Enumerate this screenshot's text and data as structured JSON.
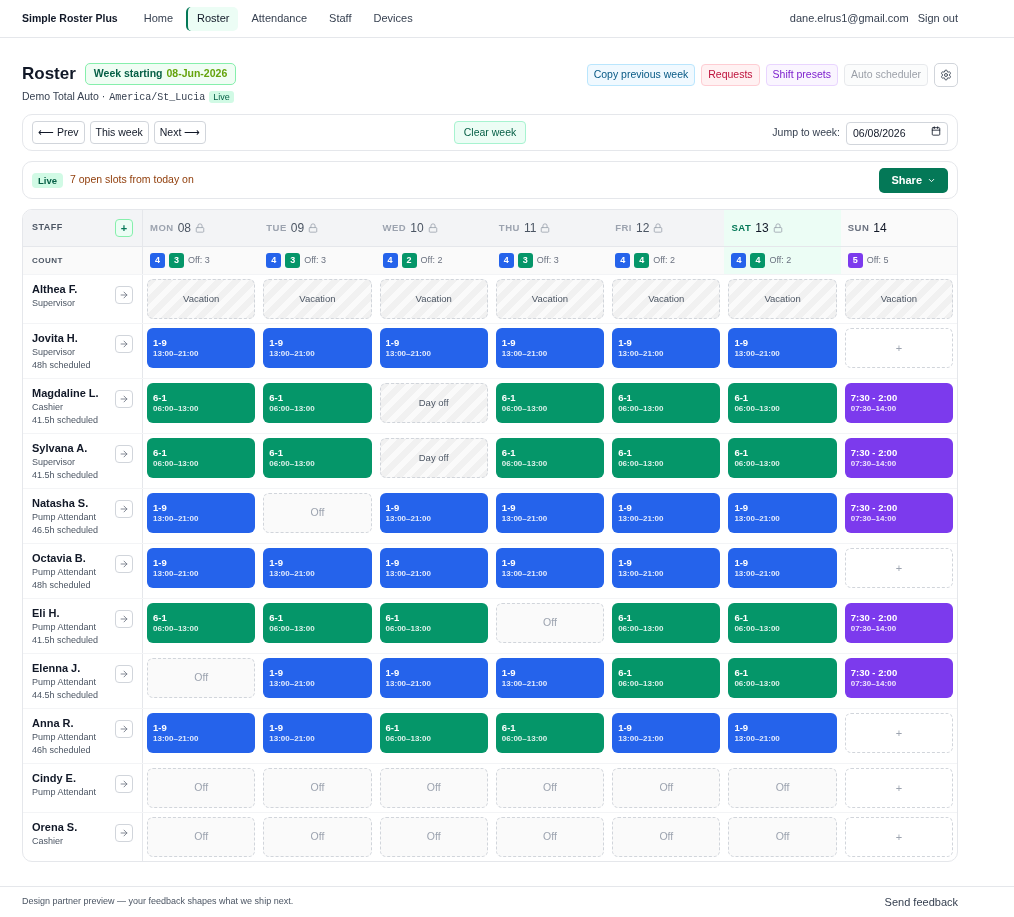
{
  "nav": {
    "brand": "Simple Roster Plus",
    "items": [
      {
        "label": "Home",
        "selected": false
      },
      {
        "label": "Roster",
        "selected": true
      },
      {
        "label": "Attendance",
        "selected": false
      },
      {
        "label": "Staff",
        "selected": false
      },
      {
        "label": "Devices",
        "selected": false
      }
    ],
    "user_email": "dane.elrus1@gmail.com",
    "sign_out": "Sign out"
  },
  "header": {
    "title": "Roster",
    "week_badge": {
      "label": "Week starting",
      "date": "08-Jun-2026"
    },
    "org": "Demo Total Auto ·",
    "timezone": "America/St_Lucia",
    "live_badge": "Live",
    "actions": [
      {
        "label": "Copy previous week",
        "kind": "info",
        "disabled": false
      },
      {
        "label": "Requests",
        "kind": "danger",
        "disabled": false
      },
      {
        "label": "Shift presets",
        "kind": "accent",
        "disabled": false
      },
      {
        "label": "Auto scheduler",
        "kind": "neutral",
        "disabled": true
      }
    ]
  },
  "week_nav": {
    "buttons": [
      "⟵ Prev",
      "This week",
      "Next ⟶"
    ],
    "clear_button": "Clear week",
    "jump_label": "Jump to week:",
    "jump_value": "06/08/2026"
  },
  "status": {
    "badge": "Live",
    "message": "7 open slots from today on",
    "share_button": "Share"
  },
  "roster": {
    "staff_heading": "STAFF",
    "add_button": "+",
    "count_heading": "COUNT",
    "days": [
      {
        "name": "MON",
        "date": "08",
        "locked": true,
        "today": false,
        "counts": [
          {
            "value": "4",
            "color": "#2563eb"
          },
          {
            "value": "3",
            "color": "#059669"
          }
        ],
        "off": "Off: 3"
      },
      {
        "name": "TUE",
        "date": "09",
        "locked": true,
        "today": false,
        "counts": [
          {
            "value": "4",
            "color": "#2563eb"
          },
          {
            "value": "3",
            "color": "#059669"
          }
        ],
        "off": "Off: 3"
      },
      {
        "name": "WED",
        "date": "10",
        "locked": true,
        "today": false,
        "counts": [
          {
            "value": "4",
            "color": "#2563eb"
          },
          {
            "value": "2",
            "color": "#059669"
          }
        ],
        "off": "Off: 2"
      },
      {
        "name": "THU",
        "date": "11",
        "locked": true,
        "today": false,
        "counts": [
          {
            "value": "4",
            "color": "#2563eb"
          },
          {
            "value": "3",
            "color": "#059669"
          }
        ],
        "off": "Off: 3"
      },
      {
        "name": "FRI",
        "date": "12",
        "locked": true,
        "today": false,
        "counts": [
          {
            "value": "4",
            "color": "#2563eb"
          },
          {
            "value": "4",
            "color": "#059669"
          }
        ],
        "off": "Off: 2"
      },
      {
        "name": "SAT",
        "date": "13",
        "locked": true,
        "today": true,
        "counts": [
          {
            "value": "4",
            "color": "#2563eb"
          },
          {
            "value": "4",
            "color": "#059669"
          }
        ],
        "off": "Off: 2"
      },
      {
        "name": "SUN",
        "date": "14",
        "locked": false,
        "today": false,
        "counts": [
          {
            "value": "5",
            "color": "#7c3aed"
          }
        ],
        "off": "Off: 5"
      }
    ],
    "staff": [
      {
        "name": "Althea F.",
        "role": "Supervisor",
        "cells": [
          {
            "kind": "vacation",
            "label": "Vacation"
          },
          {
            "kind": "vacation",
            "label": "Vacation"
          },
          {
            "kind": "vacation",
            "label": "Vacation"
          },
          {
            "kind": "vacation",
            "label": "Vacation"
          },
          {
            "kind": "vacation",
            "label": "Vacation"
          },
          {
            "kind": "vacation",
            "label": "Vacation"
          },
          {
            "kind": "vacation",
            "label": "Vacation"
          }
        ]
      },
      {
        "name": "Jovita H.",
        "role": "Supervisor",
        "hours": "48h scheduled",
        "cells": [
          {
            "kind": "shift",
            "code": "1-9",
            "time": "13:00–21:00",
            "color": "#2563eb"
          },
          {
            "kind": "shift",
            "code": "1-9",
            "time": "13:00–21:00",
            "color": "#2563eb"
          },
          {
            "kind": "shift",
            "code": "1-9",
            "time": "13:00–21:00",
            "color": "#2563eb"
          },
          {
            "kind": "shift",
            "code": "1-9",
            "time": "13:00–21:00",
            "color": "#2563eb"
          },
          {
            "kind": "shift",
            "code": "1-9",
            "time": "13:00–21:00",
            "color": "#2563eb"
          },
          {
            "kind": "shift",
            "code": "1-9",
            "time": "13:00–21:00",
            "color": "#2563eb"
          },
          {
            "kind": "empty",
            "label": "+"
          }
        ]
      },
      {
        "name": "Magdaline L.",
        "role": "Cashier",
        "hours": "41.5h scheduled",
        "cells": [
          {
            "kind": "shift",
            "code": "6-1",
            "time": "06:00–13:00",
            "color": "#059669"
          },
          {
            "kind": "shift",
            "code": "6-1",
            "time": "06:00–13:00",
            "color": "#059669"
          },
          {
            "kind": "day_off",
            "label": "Day off"
          },
          {
            "kind": "shift",
            "code": "6-1",
            "time": "06:00–13:00",
            "color": "#059669"
          },
          {
            "kind": "shift",
            "code": "6-1",
            "time": "06:00–13:00",
            "color": "#059669"
          },
          {
            "kind": "shift",
            "code": "6-1",
            "time": "06:00–13:00",
            "color": "#059669"
          },
          {
            "kind": "shift",
            "code": "7:30 - 2:00",
            "time": "07:30–14:00",
            "color": "#7c3aed"
          }
        ]
      },
      {
        "name": "Sylvana A.",
        "role": "Supervisor",
        "hours": "41.5h scheduled",
        "cells": [
          {
            "kind": "shift",
            "code": "6-1",
            "time": "06:00–13:00",
            "color": "#059669"
          },
          {
            "kind": "shift",
            "code": "6-1",
            "time": "06:00–13:00",
            "color": "#059669"
          },
          {
            "kind": "day_off",
            "label": "Day off"
          },
          {
            "kind": "shift",
            "code": "6-1",
            "time": "06:00–13:00",
            "color": "#059669"
          },
          {
            "kind": "shift",
            "code": "6-1",
            "time": "06:00–13:00",
            "color": "#059669"
          },
          {
            "kind": "shift",
            "code": "6-1",
            "time": "06:00–13:00",
            "color": "#059669"
          },
          {
            "kind": "shift",
            "code": "7:30 - 2:00",
            "time": "07:30–14:00",
            "color": "#7c3aed"
          }
        ]
      },
      {
        "name": "Natasha S.",
        "role": "Pump Attendant",
        "hours": "46.5h scheduled",
        "cells": [
          {
            "kind": "shift",
            "code": "1-9",
            "time": "13:00–21:00",
            "color": "#2563eb"
          },
          {
            "kind": "off",
            "label": "Off"
          },
          {
            "kind": "shift",
            "code": "1-9",
            "time": "13:00–21:00",
            "color": "#2563eb"
          },
          {
            "kind": "shift",
            "code": "1-9",
            "time": "13:00–21:00",
            "color": "#2563eb"
          },
          {
            "kind": "shift",
            "code": "1-9",
            "time": "13:00–21:00",
            "color": "#2563eb"
          },
          {
            "kind": "shift",
            "code": "1-9",
            "time": "13:00–21:00",
            "color": "#2563eb"
          },
          {
            "kind": "shift",
            "code": "7:30 - 2:00",
            "time": "07:30–14:00",
            "color": "#7c3aed"
          }
        ]
      },
      {
        "name": "Octavia B.",
        "role": "Pump Attendant",
        "hours": "48h scheduled",
        "cells": [
          {
            "kind": "shift",
            "code": "1-9",
            "time": "13:00–21:00",
            "color": "#2563eb"
          },
          {
            "kind": "shift",
            "code": "1-9",
            "time": "13:00–21:00",
            "color": "#2563eb"
          },
          {
            "kind": "shift",
            "code": "1-9",
            "time": "13:00–21:00",
            "color": "#2563eb"
          },
          {
            "kind": "shift",
            "code": "1-9",
            "time": "13:00–21:00",
            "color": "#2563eb"
          },
          {
            "kind": "shift",
            "code": "1-9",
            "time": "13:00–21:00",
            "color": "#2563eb"
          },
          {
            "kind": "shift",
            "code": "1-9",
            "time": "13:00–21:00",
            "color": "#2563eb"
          },
          {
            "kind": "empty",
            "label": "+"
          }
        ]
      },
      {
        "name": "Eli H.",
        "role": "Pump Attendant",
        "hours": "41.5h scheduled",
        "cells": [
          {
            "kind": "shift",
            "code": "6-1",
            "time": "06:00–13:00",
            "color": "#059669"
          },
          {
            "kind": "shift",
            "code": "6-1",
            "time": "06:00–13:00",
            "color": "#059669"
          },
          {
            "kind": "shift",
            "code": "6-1",
            "time": "06:00–13:00",
            "color": "#059669"
          },
          {
            "kind": "off",
            "label": "Off"
          },
          {
            "kind": "shift",
            "code": "6-1",
            "time": "06:00–13:00",
            "color": "#059669"
          },
          {
            "kind": "shift",
            "code": "6-1",
            "time": "06:00–13:00",
            "color": "#059669"
          },
          {
            "kind": "shift",
            "code": "7:30 - 2:00",
            "time": "07:30–14:00",
            "color": "#7c3aed"
          }
        ]
      },
      {
        "name": "Elenna J.",
        "role": "Pump Attendant",
        "hours": "44.5h scheduled",
        "cells": [
          {
            "kind": "off",
            "label": "Off"
          },
          {
            "kind": "shift",
            "code": "1-9",
            "time": "13:00–21:00",
            "color": "#2563eb"
          },
          {
            "kind": "shift",
            "code": "1-9",
            "time": "13:00–21:00",
            "color": "#2563eb"
          },
          {
            "kind": "shift",
            "code": "1-9",
            "time": "13:00–21:00",
            "color": "#2563eb"
          },
          {
            "kind": "shift",
            "code": "6-1",
            "time": "06:00–13:00",
            "color": "#059669"
          },
          {
            "kind": "shift",
            "code": "6-1",
            "time": "06:00–13:00",
            "color": "#059669"
          },
          {
            "kind": "shift",
            "code": "7:30 - 2:00",
            "time": "07:30–14:00",
            "color": "#7c3aed"
          }
        ]
      },
      {
        "name": "Anna R.",
        "role": "Pump Attendant",
        "hours": "46h scheduled",
        "cells": [
          {
            "kind": "shift",
            "code": "1-9",
            "time": "13:00–21:00",
            "color": "#2563eb"
          },
          {
            "kind": "shift",
            "code": "1-9",
            "time": "13:00–21:00",
            "color": "#2563eb"
          },
          {
            "kind": "shift",
            "code": "6-1",
            "time": "06:00–13:00",
            "color": "#059669"
          },
          {
            "kind": "shift",
            "code": "6-1",
            "time": "06:00–13:00",
            "color": "#059669"
          },
          {
            "kind": "shift",
            "code": "1-9",
            "time": "13:00–21:00",
            "color": "#2563eb"
          },
          {
            "kind": "shift",
            "code": "1-9",
            "time": "13:00–21:00",
            "color": "#2563eb"
          },
          {
            "kind": "empty",
            "label": "+"
          }
        ]
      },
      {
        "name": "Cindy E.",
        "role": "Pump Attendant",
        "cells": [
          {
            "kind": "off",
            "label": "Off"
          },
          {
            "kind": "off",
            "label": "Off"
          },
          {
            "kind": "off",
            "label": "Off"
          },
          {
            "kind": "off",
            "label": "Off"
          },
          {
            "kind": "off",
            "label": "Off"
          },
          {
            "kind": "off",
            "label": "Off"
          },
          {
            "kind": "empty",
            "label": "+"
          }
        ]
      },
      {
        "name": "Orena S.",
        "role": "Cashier",
        "cells": [
          {
            "kind": "off",
            "label": "Off"
          },
          {
            "kind": "off",
            "label": "Off"
          },
          {
            "kind": "off",
            "label": "Off"
          },
          {
            "kind": "off",
            "label": "Off"
          },
          {
            "kind": "off",
            "label": "Off"
          },
          {
            "kind": "off",
            "label": "Off"
          },
          {
            "kind": "empty",
            "label": "+"
          }
        ]
      }
    ]
  },
  "footer": {
    "note": "Design partner preview — your feedback shapes what we ship next.",
    "feedback_link": "Send feedback"
  }
}
